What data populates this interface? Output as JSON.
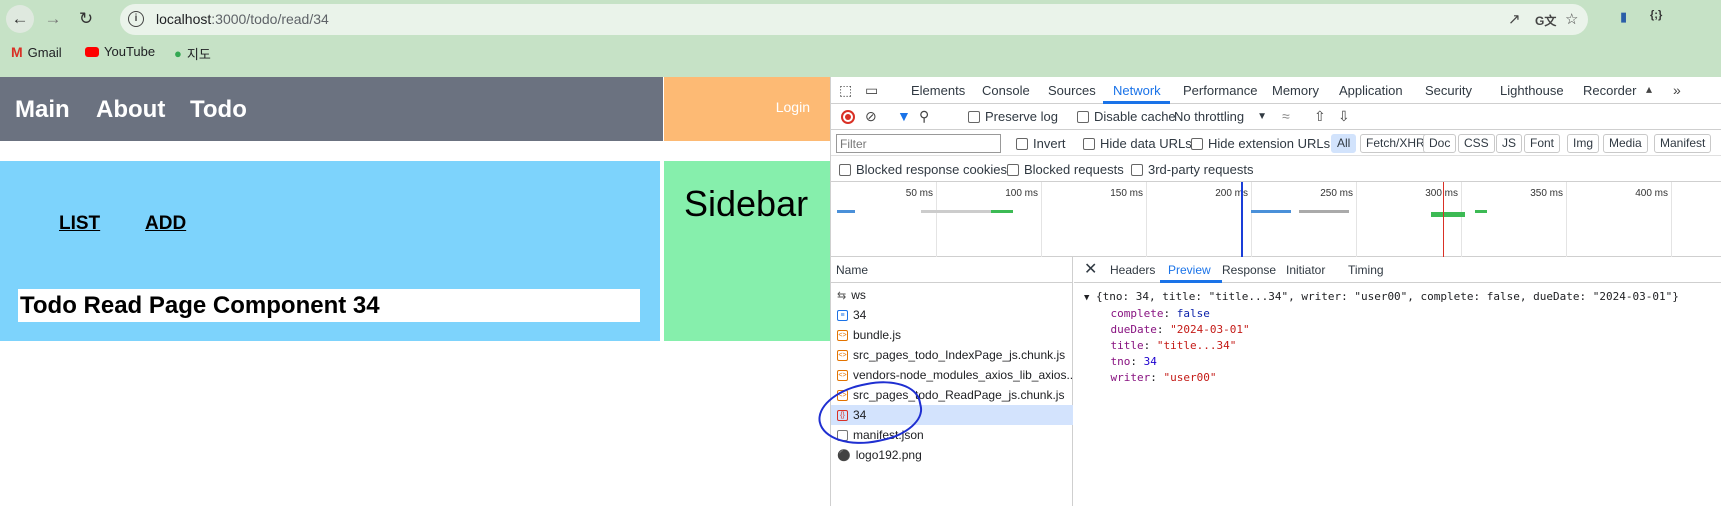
{
  "browser": {
    "url_host": "localhost",
    "url_path": ":3000/todo/read/34",
    "bookmarks": [
      {
        "label": "Gmail",
        "icon": "gmail-icon",
        "color": "#d93025"
      },
      {
        "label": "YouTube",
        "icon": "youtube-icon",
        "color": "#ff0000"
      },
      {
        "label": "지도",
        "icon": "maps-icon",
        "color": "#34a853"
      }
    ]
  },
  "app": {
    "nav": [
      "Main",
      "About",
      "Todo"
    ],
    "login": "Login",
    "sublinks": [
      "LIST",
      "ADD"
    ],
    "read_title": "Todo Read Page Component 34",
    "sidebar": "Sidebar",
    "colors": {
      "header": "#6b7280",
      "login": "#fdba74",
      "content": "#7dd3fc",
      "sidebar": "#86efac"
    }
  },
  "devtools": {
    "tabs": [
      "Elements",
      "Console",
      "Sources",
      "Network",
      "Performance",
      "Memory",
      "Application",
      "Security",
      "Lighthouse",
      "Recorder"
    ],
    "active_tab": "Network",
    "toolbar": {
      "preserve_log": "Preserve log",
      "disable_cache": "Disable cache",
      "throttling": "No throttling"
    },
    "filter": {
      "placeholder": "Filter",
      "invert": "Invert",
      "hide_data_urls": "Hide data URLs",
      "hide_extension_urls": "Hide extension URLs",
      "chips": [
        "All",
        "Fetch/XHR",
        "Doc",
        "CSS",
        "JS",
        "Font",
        "Img",
        "Media",
        "Manifest"
      ],
      "blocked_cookies": "Blocked response cookies",
      "blocked_requests": "Blocked requests",
      "third_party": "3rd-party requests"
    },
    "timeline_ticks": [
      "50 ms",
      "100 ms",
      "150 ms",
      "200 ms",
      "250 ms",
      "300 ms",
      "350 ms",
      "400 ms"
    ],
    "name_header": "Name",
    "requests": [
      {
        "name": "ws",
        "icon": "websocket-icon"
      },
      {
        "name": "34",
        "icon": "document-icon"
      },
      {
        "name": "bundle.js",
        "icon": "script-icon"
      },
      {
        "name": "src_pages_todo_IndexPage_js.chunk.js",
        "icon": "script-icon"
      },
      {
        "name": "vendors-node_modules_axios_lib_axios...",
        "icon": "script-icon"
      },
      {
        "name": "src_pages_todo_ReadPage_js.chunk.js",
        "icon": "script-icon"
      },
      {
        "name": "34",
        "icon": "fetch-icon",
        "selected": true
      },
      {
        "name": "manifest.json",
        "icon": "file-icon"
      },
      {
        "name": "logo192.png",
        "icon": "image-icon"
      }
    ],
    "detail_tabs": [
      "Headers",
      "Preview",
      "Response",
      "Initiator",
      "Timing"
    ],
    "active_detail_tab": "Preview",
    "preview": {
      "summary": "{tno: 34, title: \"title...34\", writer: \"user00\", complete: false, dueDate: \"2024-03-01\"}",
      "fields": [
        {
          "key": "complete",
          "value": "false",
          "type": "b"
        },
        {
          "key": "dueDate",
          "value": "\"2024-03-01\"",
          "type": "s"
        },
        {
          "key": "title",
          "value": "\"title...34\"",
          "type": "s"
        },
        {
          "key": "tno",
          "value": "34",
          "type": "n"
        },
        {
          "key": "writer",
          "value": "\"user00\"",
          "type": "s"
        }
      ]
    }
  }
}
